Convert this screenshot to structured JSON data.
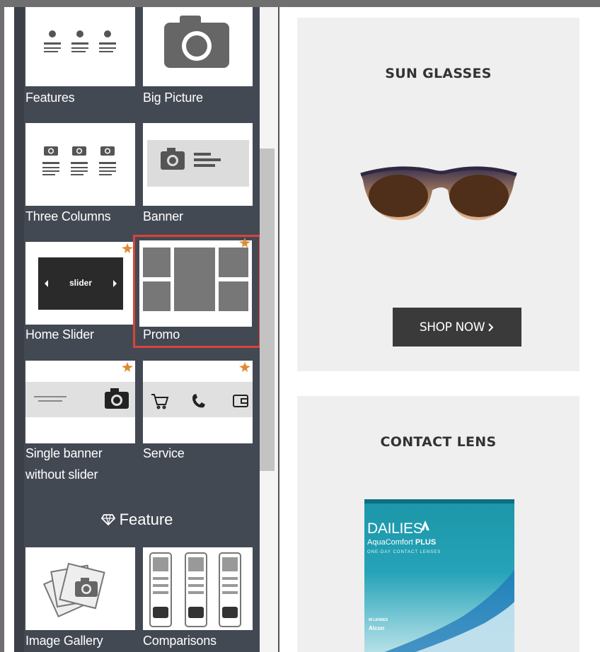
{
  "sidebar": {
    "blocks": [
      {
        "label": "Features"
      },
      {
        "label": "Big Picture"
      },
      {
        "label": "Three Columns"
      },
      {
        "label": "Banner"
      },
      {
        "label": "Home Slider",
        "tile_text": "slider"
      },
      {
        "label": "Promo"
      },
      {
        "label": "Single banner",
        "label2": "without slider"
      },
      {
        "label": "Service"
      },
      {
        "label": "Image Gallery"
      },
      {
        "label": "Comparisons"
      }
    ],
    "section_heading": "Feature",
    "section_icon": "diamond-icon"
  },
  "main": {
    "cards": [
      {
        "title": "SUN GLASSES",
        "button": "SHOP NOW",
        "button_icon": "chevron-right-icon"
      },
      {
        "title": "CONTACT LENS",
        "box_brand": "DAILIES",
        "box_subtitle": "AquaComfort",
        "box_subtitle2": "PLUS",
        "box_tagline": "ONE-DAY CONTACT LENSES",
        "box_count": "90 LENSES",
        "box_maker": "Alcon"
      }
    ]
  },
  "colors": {
    "sidebar_bg": "#434953",
    "highlight": "#d8443a",
    "button_bg": "#3a3a3a",
    "card_bg": "#efefef"
  }
}
